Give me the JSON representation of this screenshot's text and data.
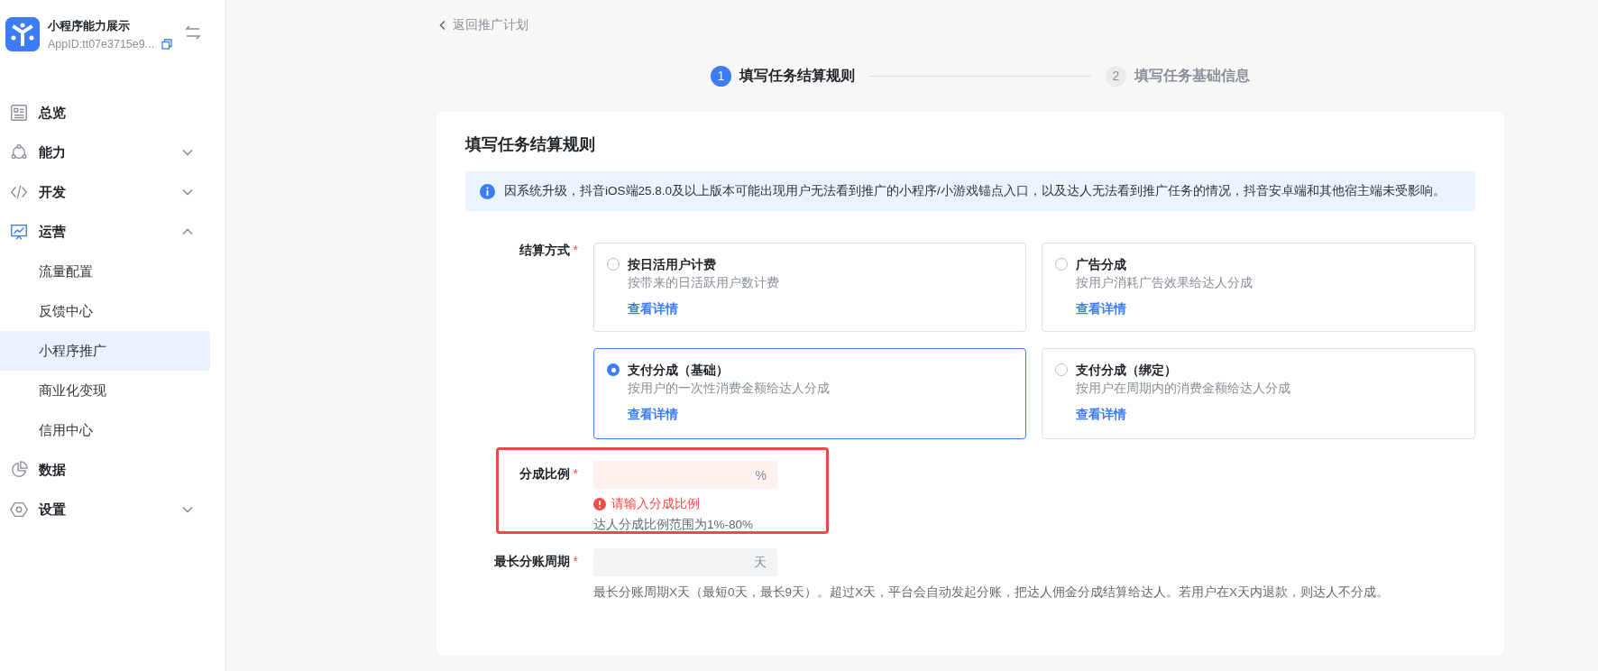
{
  "app": {
    "name": "小程序能力展示",
    "app_id": "AppID:tt07e3715e9..."
  },
  "sidebar": {
    "items": [
      {
        "label": "总览",
        "selected": false
      },
      {
        "label": "能力",
        "selected": false,
        "expanded": false
      },
      {
        "label": "开发",
        "selected": false,
        "expanded": false
      },
      {
        "label": "运营",
        "selected": false,
        "expanded": true,
        "children": [
          {
            "label": "流量配置",
            "selected": false
          },
          {
            "label": "反馈中心",
            "selected": false
          },
          {
            "label": "小程序推广",
            "selected": true
          },
          {
            "label": "商业化变现",
            "selected": false
          },
          {
            "label": "信用中心",
            "selected": false
          }
        ]
      },
      {
        "label": "数据",
        "selected": false
      },
      {
        "label": "设置",
        "selected": false,
        "expanded": false
      }
    ]
  },
  "back_link": "返回推广计划",
  "steps": [
    {
      "number": "1",
      "label": "填写任务结算规则",
      "selected": true
    },
    {
      "number": "2",
      "label": "填写任务基础信息",
      "selected": false
    }
  ],
  "form": {
    "title": "填写任务结算规则",
    "notice": "因系统升级，抖音iOS端25.8.0及以上版本可能出现用户无法看到推广的小程序/小游戏锚点入口，以及达人无法看到推广任务的情况，抖音安卓端和其他宿主端未受影响。",
    "fields": [
      {
        "kind": "options",
        "label": "结算方式",
        "required_mark": "*",
        "options": [
          {
            "title": "按日活用户计费",
            "description": "按带来的日活跃用户数计费",
            "link": "查看详情",
            "selected": false
          },
          {
            "title": "广告分成",
            "description": "按用户消耗广告效果给达人分成",
            "link": "查看详情",
            "selected": false
          },
          {
            "title": "支付分成（基础）",
            "description": "按用户的一次性消费金额给达人分成",
            "link": "查看详情",
            "selected": true
          },
          {
            "title": "支付分成（绑定）",
            "description": "按用户在周期内的消费金额给达人分成",
            "link": "查看详情",
            "selected": false
          }
        ]
      },
      {
        "kind": "input",
        "label": "分成比例",
        "required_mark": "*",
        "suffix": "%",
        "error": "请输入分成比例",
        "hint": "达人分成比例范围为1%-80%",
        "highlighted": true
      },
      {
        "kind": "input",
        "label": "最长分账周期",
        "required_mark": "*",
        "suffix": "天",
        "hint": "最长分账周期X天（最短0天，最长9天）。超过X天，平台会自动发起分账，把达人佣金分成结算给达人。若用户在X天内退款，则达人不分成。"
      }
    ]
  }
}
